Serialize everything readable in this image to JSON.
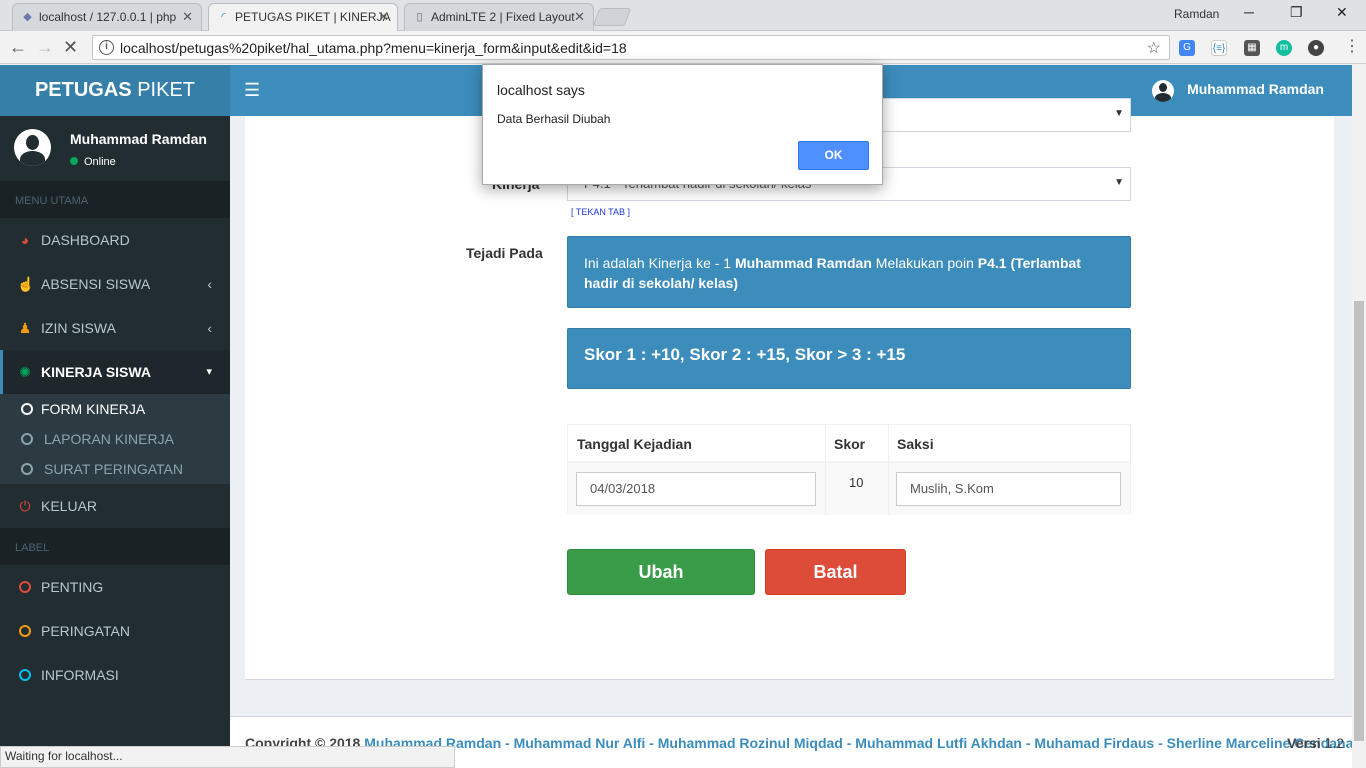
{
  "browser": {
    "tabs": [
      {
        "title": "localhost / 127.0.0.1 | php",
        "icon": "phpmyadmin-icon"
      },
      {
        "title": "PETUGAS PIKET | KINERJA",
        "icon": "loading-icon"
      },
      {
        "title": "AdminLTE 2 | Fixed Layout",
        "icon": "page-icon"
      }
    ],
    "user": "Ramdan",
    "url": "localhost/petugas%20piket/hal_utama.php?menu=kinerja_form&input&edit&id=18",
    "status": "Waiting for localhost..."
  },
  "header": {
    "logo_bold": "PETUGAS",
    "logo_rest": " PIKET",
    "user_name": "Muhammad Ramdan"
  },
  "sidebar": {
    "user_name": "Muhammad Ramdan",
    "status": "Online",
    "menu_header": "MENU UTAMA",
    "items": [
      {
        "label": "DASHBOARD",
        "icon": "dashboard-icon"
      },
      {
        "label": "ABSENSI SISWA",
        "icon": "hand-pointer-icon"
      },
      {
        "label": "IZIN SISWA",
        "icon": "person-icon"
      },
      {
        "label": "KINERJA SISWA",
        "icon": "spinner-icon"
      }
    ],
    "submenu": [
      {
        "label": "FORM KINERJA"
      },
      {
        "label": "LAPORAN KINERJA"
      },
      {
        "label": "SURAT PERINGATAN"
      }
    ],
    "logout": "KELUAR",
    "label_header": "LABEL",
    "labels": [
      {
        "label": "PENTING",
        "color": "#dd4b39"
      },
      {
        "label": "PERINGATAN",
        "color": "#f39c12"
      },
      {
        "label": "INFORMASI",
        "color": "#00c0ef"
      }
    ]
  },
  "form": {
    "kinerja_label": "Kinerja",
    "kinerja_value": "P4.1 - Terlambat hadir di sekolah/ kelas",
    "hint": "[ TEKAN TAB ]",
    "terjadi_label": "Tejadi Pada",
    "info_prefix": "Ini adalah Kinerja ke - 1 ",
    "info_name": "Muhammad Ramdan",
    "info_mid": " Melakukan poin ",
    "info_point": "P4.1 (Terlambat hadir di sekolah/ kelas)",
    "score_text": "Skor 1 : +10, Skor 2 : +15, Skor > 3 : +15",
    "table": {
      "headers": [
        "Tanggal Kejadian",
        "Skor",
        "Saksi"
      ],
      "date": "04/03/2018",
      "score": "10",
      "witness": "Muslih, S.Kom"
    },
    "submit": "Ubah",
    "cancel": "Batal"
  },
  "footer": {
    "prefix": "Copyright © 2018 ",
    "authors": "Muhammad Ramdan - Muhammad Nur Alfi - Muhammad Rozinul Miqdad - Muhammad Lutfi Akhdan - Muhamad Firdaus - Sherline Marceline Cendana",
    "version_label": "Versi",
    "version": "1.2"
  },
  "dialog": {
    "title": "localhost says",
    "message": "Data Berhasil Diubah",
    "ok": "OK"
  },
  "colors": {
    "primary": "#3c8dbc",
    "sidebar": "#222d32",
    "success": "#3a9c48",
    "danger": "#dd4b39"
  }
}
